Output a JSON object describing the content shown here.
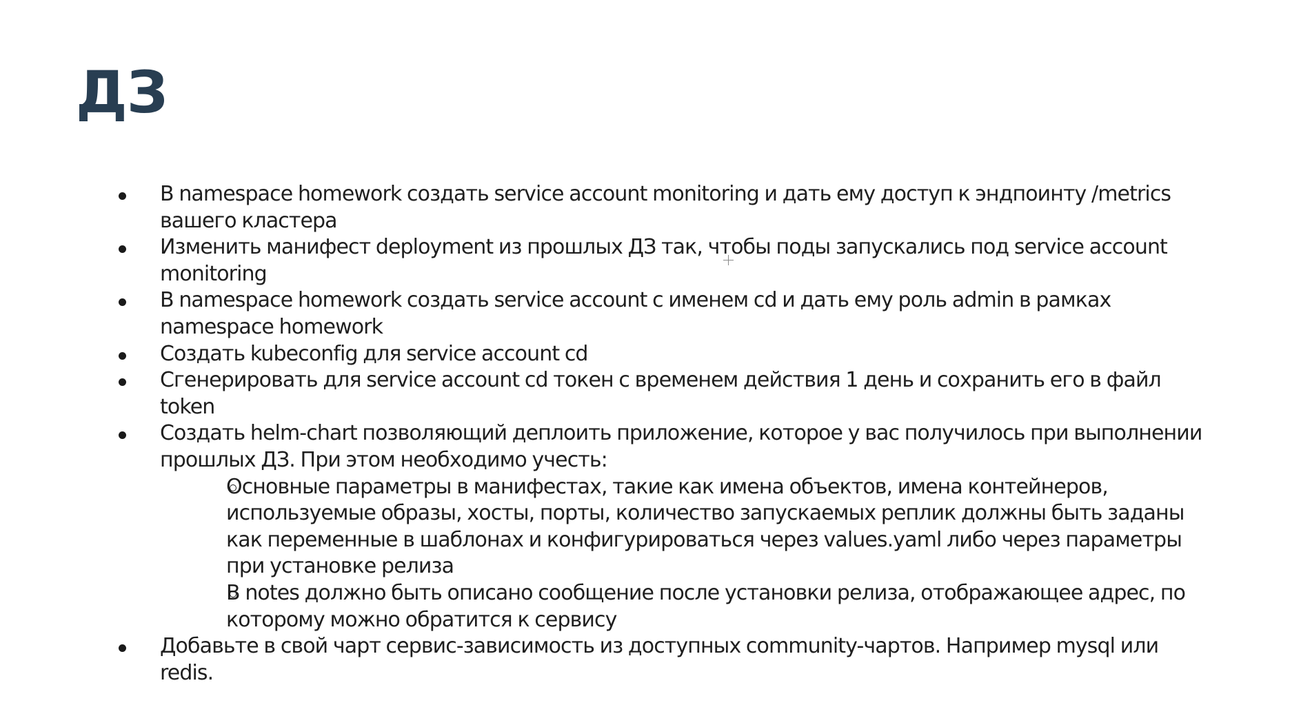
{
  "slide": {
    "title": "ДЗ",
    "items": [
      {
        "text": "В namespace homework создать service account monitoring и дать ему доступ к эндпоинту /metrics вашего кластера"
      },
      {
        "text": "Изменить манифест deployment из прошлых ДЗ так, чтобы поды запускались под service account monitoring"
      },
      {
        "text": "В namespace homework создать service account с именем cd и дать ему роль admin в рамках namespace homework"
      },
      {
        "text": "Создать kubeconfig для service account cd"
      },
      {
        "text": "Сгенерировать для service account cd токен с временем действия 1 день и сохранить его в файл token"
      },
      {
        "text": "Создать helm-chart позволяющий деплоить приложение, которое у вас получилось при выполнении прошлых ДЗ. При этом необходимо учесть:",
        "subitems": [
          {
            "text": "Основные параметры в манифестах, такие как имена объектов, имена контейнеров, используемые образы, хосты, порты, количество запускаемых реплик должны быть заданы как переменные в шаблонах и конфигурироваться через values.yaml либо через параметры при установке релиза"
          },
          {
            "text": "В notes должно быть описано сообщение после установки релиза, отображающее адрес, по которому можно обратится к сервису"
          }
        ]
      },
      {
        "text": "Добавьте в свой чарт сервис-зависимость из доступных community-чартов. Например mysql или redis."
      }
    ]
  }
}
